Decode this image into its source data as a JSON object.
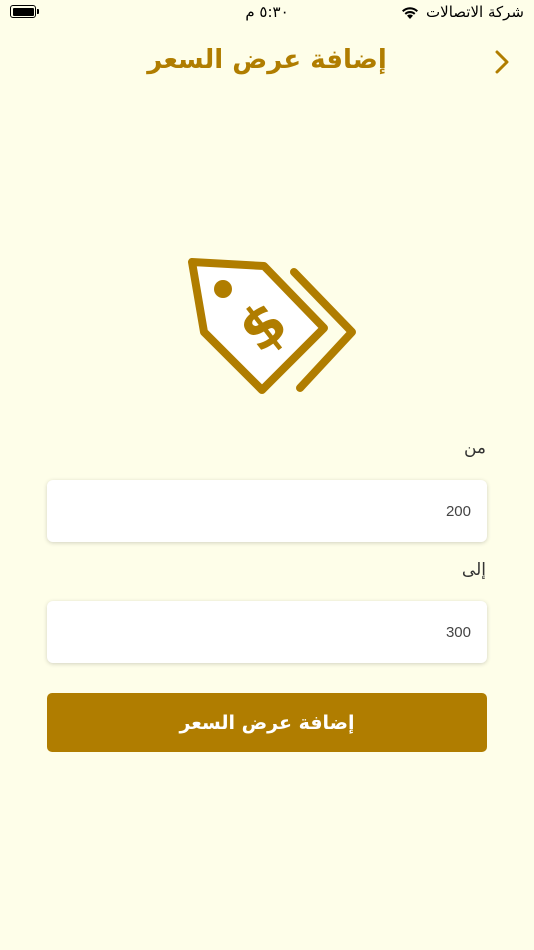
{
  "status_bar": {
    "carrier": "شركة الاتصالات",
    "time": "٥:٣٠ م",
    "wifi_icon": "wifi-icon",
    "battery_icon": "battery-full-icon"
  },
  "header": {
    "title": "إضافة عرض السعر",
    "back_icon": "chevron-right-icon"
  },
  "hero": {
    "icon": "price-tags-icon"
  },
  "form": {
    "from_label": "من",
    "from_value": "200",
    "to_label": "إلى",
    "to_value": "300"
  },
  "submit_label": "إضافة عرض السعر",
  "colors": {
    "accent": "#b07d00",
    "background": "#fefee9"
  }
}
